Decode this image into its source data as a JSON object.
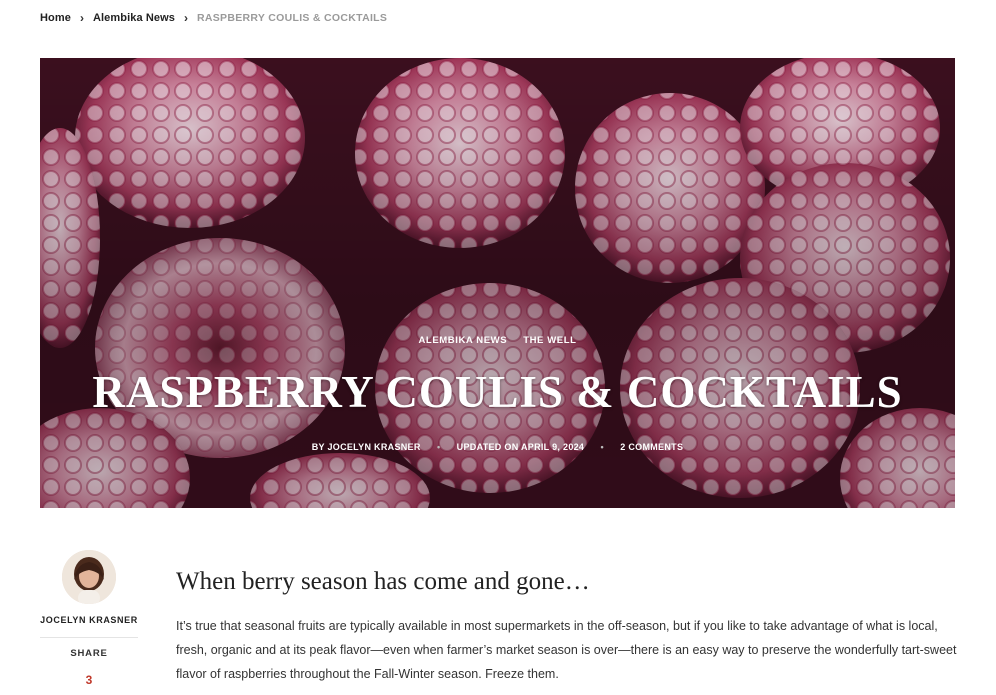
{
  "breadcrumb": {
    "home": "Home",
    "section": "Alembika News",
    "current": "RASPBERRY COULIS & COCKTAILS"
  },
  "hero": {
    "categories": [
      "ALEMBIKA NEWS",
      "THE WELL"
    ],
    "title": "RASPBERRY COULIS & COCKTAILS",
    "author": "BY JOCELYN KRASNER",
    "updated": "UPDATED ON APRIL 9, 2024",
    "comments": "2 COMMENTS"
  },
  "sidebar": {
    "author_name": "JOCELYN KRASNER",
    "share_label": "SHARE",
    "share_count": "3"
  },
  "article": {
    "lede": "When berry season has come and gone…",
    "body": "It’s true that seasonal fruits are typically available in most supermarkets in the off-season, but if you like to take advantage of what is local, fresh, organic and at its peak flavor—even when farmer’s market season is over—there is an easy way to preserve the wonderfully tart-sweet flavor of raspberries throughout the Fall-Winter season. Freeze them."
  },
  "colors": {
    "accent": "#c0392b",
    "berry": "#c2436a",
    "frost": "#f3dfe7"
  }
}
